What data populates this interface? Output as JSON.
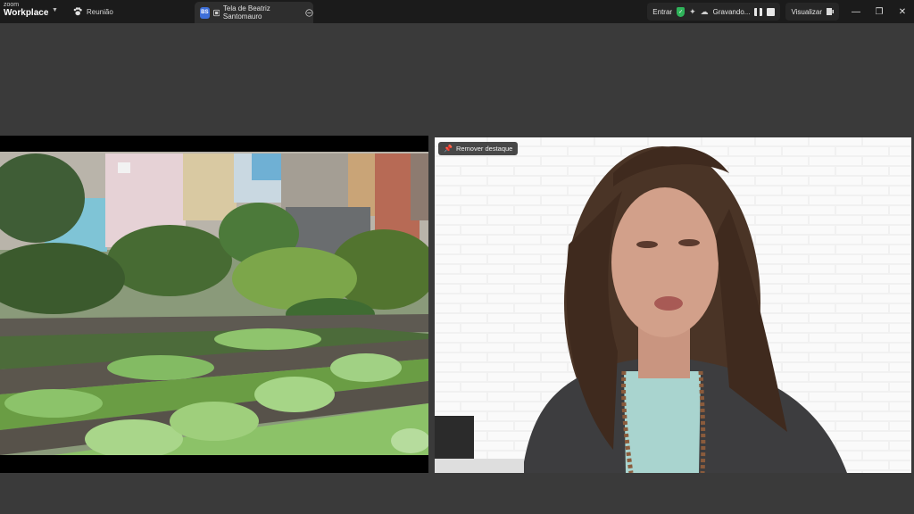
{
  "app": {
    "brand_small": "zoom",
    "brand_large": "Workplace"
  },
  "tabs": {
    "meeting_label": "Reunião",
    "share_label": "Tela de Beatriz Santomauro",
    "share_badge": "BS"
  },
  "toolbar": {
    "enter_label": "Entrar",
    "recording_label": "Gravando...",
    "view_label": "Visualizar"
  },
  "video": {
    "unpin_label": "Remover destaque"
  },
  "colors": {
    "titlebar": "#1b1b1b",
    "background": "#3a3a3a",
    "security_green": "#2fb35a",
    "badge_blue": "#3e6fd8"
  },
  "icons": {
    "meeting": "paw-icon",
    "share": "screen-share-icon",
    "more": "more-options-icon",
    "shield": "shield-check-icon",
    "mic": "mic-sparkle-icon",
    "cloud": "cloud-record-icon",
    "unpin": "unpin-icon"
  }
}
